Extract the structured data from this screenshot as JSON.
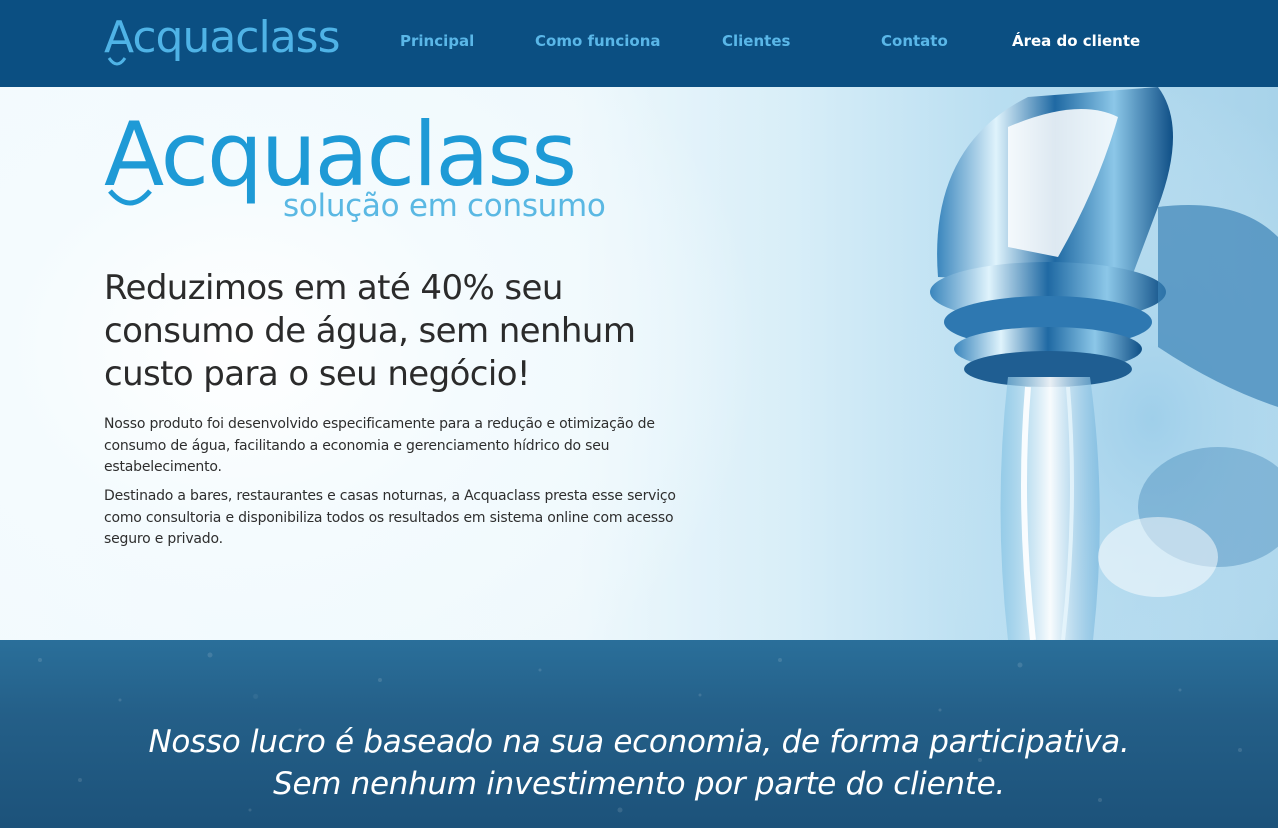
{
  "nav": {
    "logo_text": "Acquaclass",
    "links": [
      {
        "label": "Principal"
      },
      {
        "label": "Como funciona"
      },
      {
        "label": "Clientes"
      },
      {
        "label": "Contato"
      },
      {
        "label": "Área do cliente"
      }
    ]
  },
  "hero": {
    "logo_text": "Acquaclass",
    "tagline": "solução em consumo",
    "headline": "Reduzimos em até 40% seu consumo de água, sem nenhum custo para o seu negócio!",
    "paragraph_1": "Nosso produto foi desenvolvido especificamente para a redução e otimização de consumo de água, facilitando a economia e gerenciamento hídrico do seu estabelecimento.",
    "paragraph_2": "Destinado a bares, restaurantes e casas noturnas, a Acquaclass presta esse serviço como consultoria e disponibiliza todos os resultados em sistema online com acesso seguro e privado."
  },
  "band": {
    "quote_line_1": "Nosso lucro é baseado na sua economia, de forma participativa.",
    "quote_line_2": "Sem nenhum investimento por parte do cliente."
  },
  "colors": {
    "nav_bg": "#0b4f82",
    "nav_link": "#5ab7e8",
    "brand_blue": "#1e9ad6",
    "tagline": "#5ab8e3",
    "band_bg": "#245f88"
  }
}
